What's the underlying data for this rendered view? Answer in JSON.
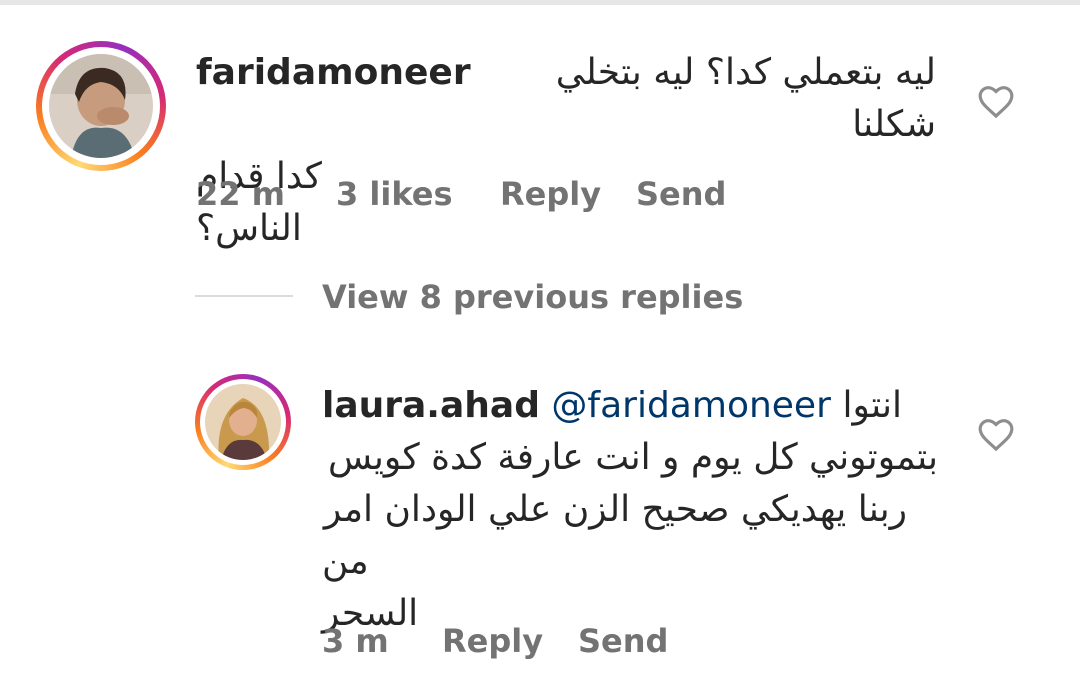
{
  "comments": [
    {
      "username": "faridamoneer",
      "text_line1": "ليه بتعملي كدا؟ ليه بتخلي شكلنا",
      "text_line2": "كدا قدام الناس؟",
      "time": "22 m",
      "likes": "3 likes",
      "reply_label": "Reply",
      "send_label": "Send"
    },
    {
      "username": "laura.ahad",
      "mention": "@faridamoneer",
      "text_line1": "انتوا",
      "text_line2": "بتموتوني كل يوم و انت عارفة كدة كويس",
      "text_line3": "ربنا يهديكي صحيح الزن علي الودان امر",
      "text_line4": "من السحر",
      "time": "3 m",
      "reply_label": "Reply",
      "send_label": "Send"
    }
  ],
  "view_replies_label": "View 8 previous replies",
  "colors": {
    "mention": "#00376b",
    "meta": "#737373",
    "text": "#262626"
  },
  "icons": {
    "like": "heart-outline-icon"
  }
}
